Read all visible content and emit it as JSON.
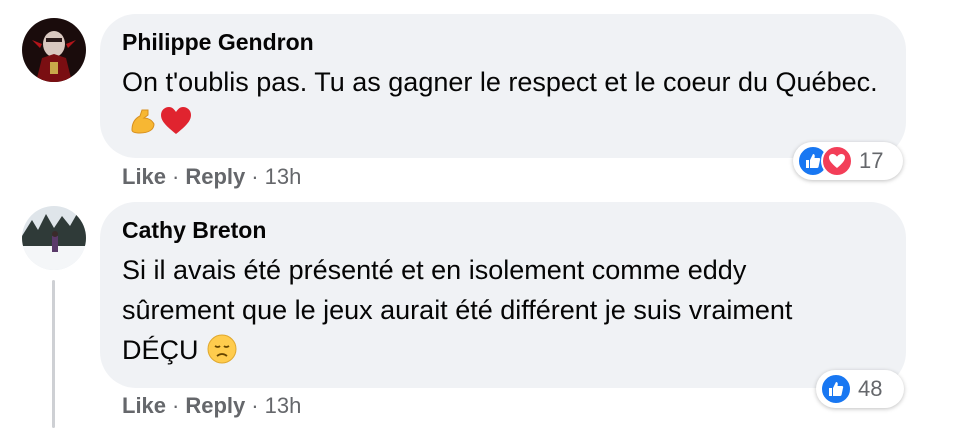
{
  "comments": [
    {
      "author": "Philippe Gendron",
      "text": "On t'oublis pas. Tu as gagner le respect et le coeur du Québec.",
      "actions": {
        "like": "Like",
        "reply": "Reply",
        "time": "13h",
        "dot": "·"
      },
      "reactions": {
        "count": "17",
        "types": [
          "like",
          "love"
        ]
      },
      "emojis": [
        "flexed-biceps",
        "red-heart"
      ]
    },
    {
      "author": "Cathy Breton",
      "text": "Si il avais été présenté et en isolement comme eddy sûrement que le jeux aurait été différent je suis vraiment DÉÇU",
      "actions": {
        "like": "Like",
        "reply": "Reply",
        "time": "13h",
        "dot": "·"
      },
      "reactions": {
        "count": "48",
        "types": [
          "like"
        ]
      },
      "emojis": [
        "disappointed-face"
      ]
    }
  ],
  "colors": {
    "like": "#1877f2",
    "love": "#f33e58",
    "bubble": "#f0f2f5",
    "meta": "#65676b"
  }
}
